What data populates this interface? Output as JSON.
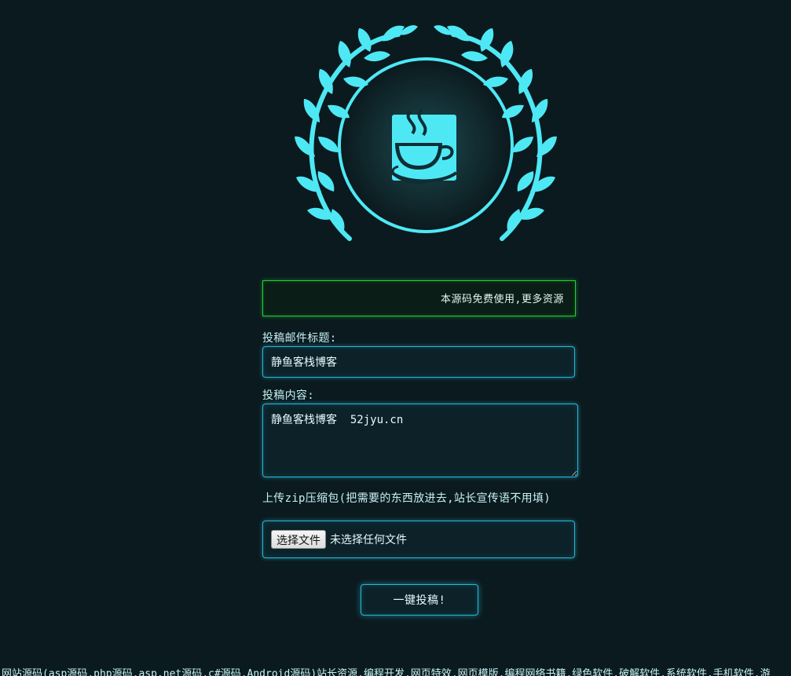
{
  "banner": {
    "marquee_text": "本源码免费使用,更多资源"
  },
  "form": {
    "title_label": "投稿邮件标题:",
    "title_value": "静鱼客栈博客",
    "content_label": "投稿内容:",
    "content_value": "静鱼客栈博客  52jyu.cn",
    "upload_label": "上传zip压缩包(把需要的东西放进去,站长宣传语不用填)",
    "file_button_label": "选择文件",
    "file_status": "未选择任何文件",
    "submit_label": "一键投稿!"
  },
  "footer": {
    "links_text": "网站源码(asp源码,php源码,asp.net源码,c#源码,Android源码)站长资源,编程开发,网页特效,网页模版,编程网络书籍,绿色软件,破解软件,系统软件,手机软件,游"
  },
  "icons": {
    "emblem": "laurel-wreath-icon",
    "cup": "coffee-cup-icon"
  },
  "colors": {
    "background": "#0b1a1e",
    "accent_cyan": "#4ee8f5",
    "input_border": "#29b6d8",
    "marquee_border": "#22d03a"
  }
}
